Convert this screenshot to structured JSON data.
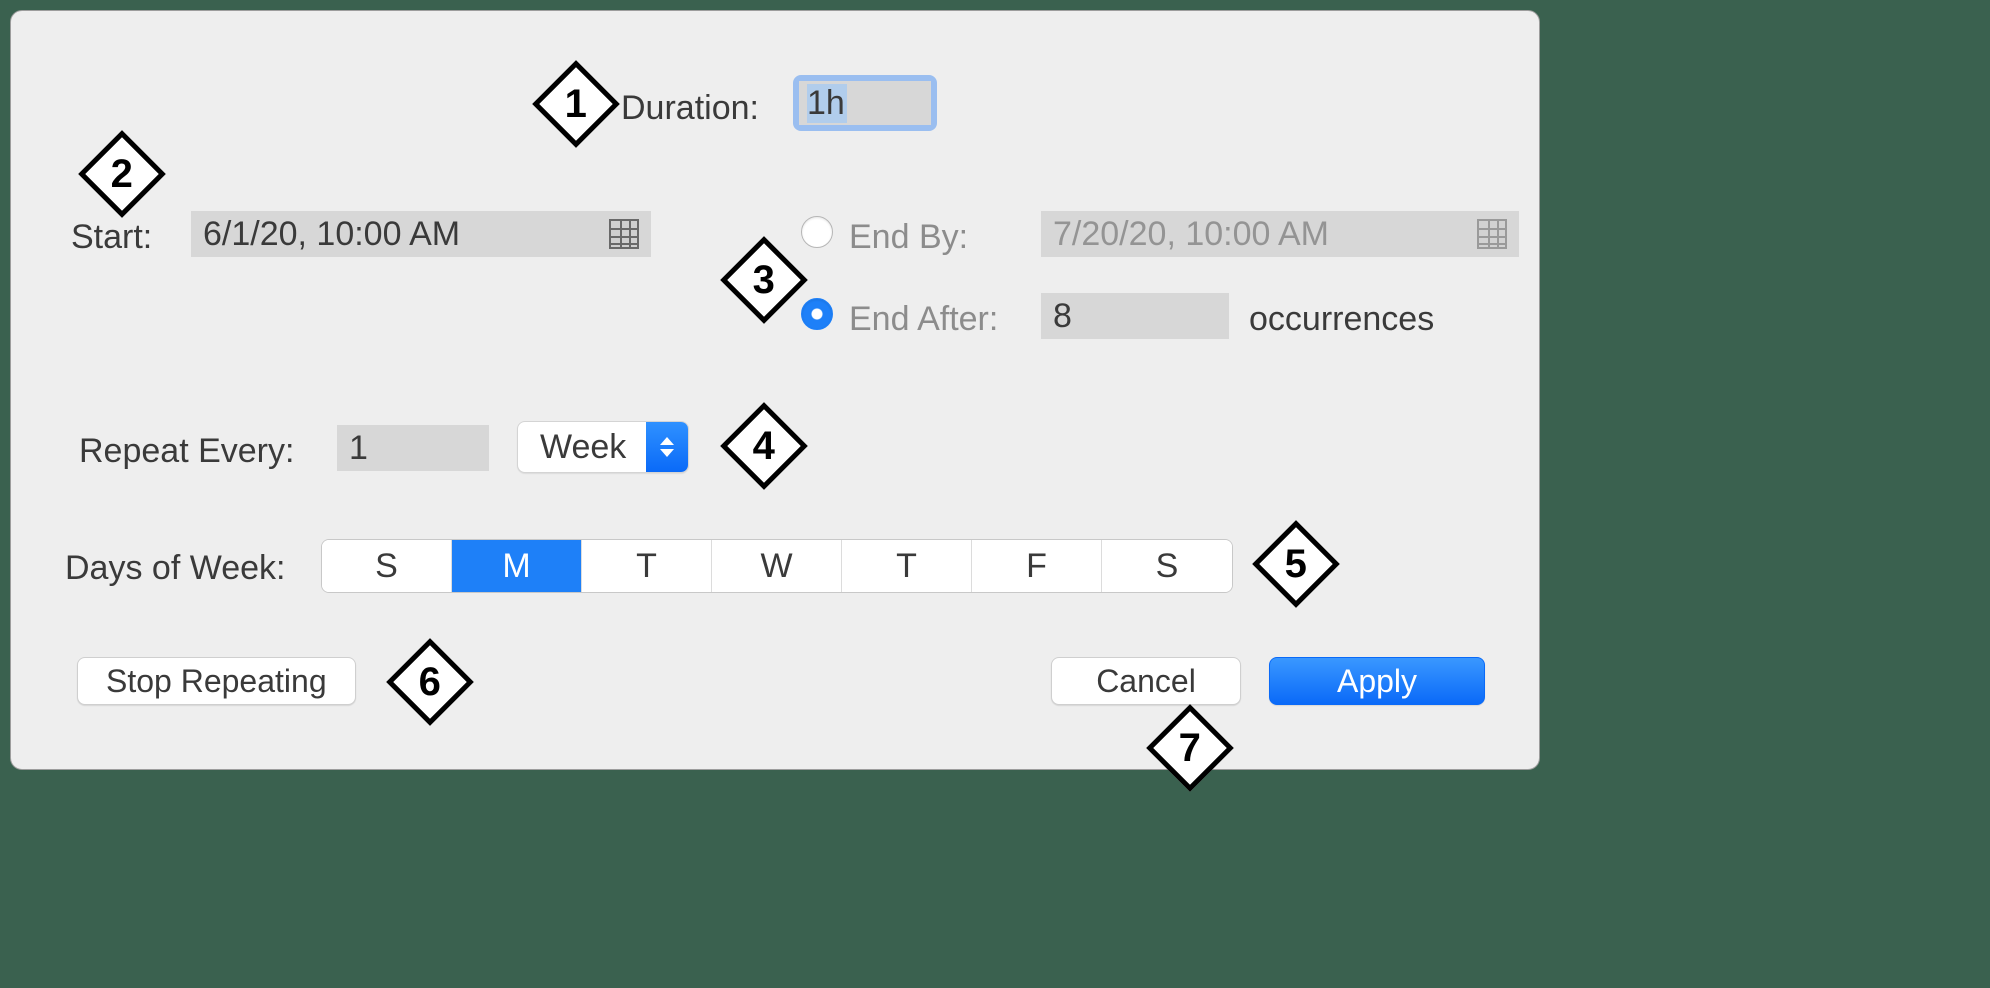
{
  "duration": {
    "label": "Duration:",
    "value": "1h"
  },
  "start": {
    "label": "Start:",
    "value": "6/1/20, 10:00 AM"
  },
  "end_by": {
    "label": "End By:",
    "value": "7/20/20, 10:00 AM",
    "selected": false
  },
  "end_after": {
    "label": "End After:",
    "value": "8",
    "unit": "occurrences",
    "selected": true
  },
  "repeat": {
    "label": "Repeat Every:",
    "count": "1",
    "unit": "Week"
  },
  "days": {
    "label": "Days of Week:",
    "items": [
      "S",
      "M",
      "T",
      "W",
      "T",
      "F",
      "S"
    ],
    "selected_index": 1
  },
  "buttons": {
    "stop": "Stop Repeating",
    "cancel": "Cancel",
    "apply": "Apply"
  },
  "callouts": [
    "1",
    "2",
    "3",
    "4",
    "5",
    "6",
    "7"
  ]
}
